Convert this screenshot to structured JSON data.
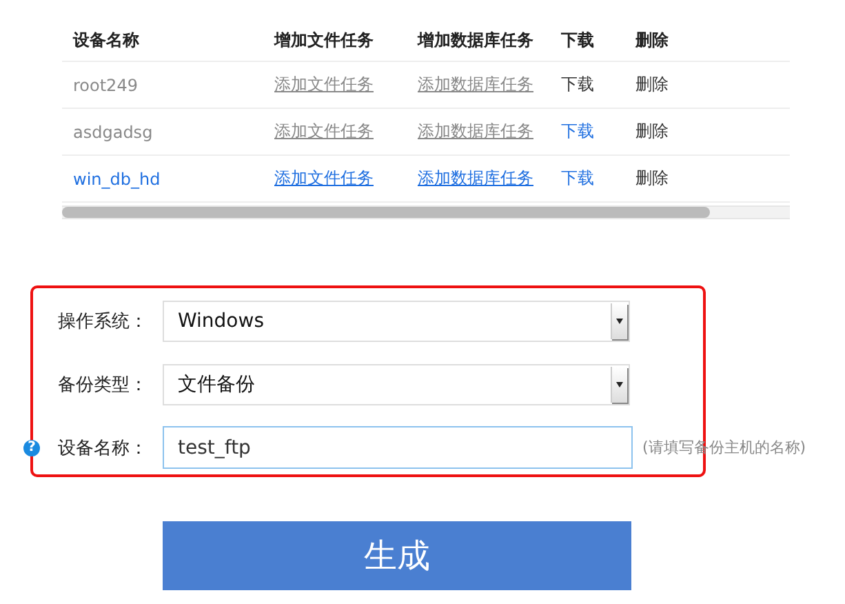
{
  "table": {
    "columns": [
      "设备名称",
      "增加文件任务",
      "增加数据库任务",
      "下载",
      "删除"
    ],
    "rows": [
      {
        "name": "root249",
        "add_file_task": "添加文件任务",
        "add_db_task": "添加数据库任务",
        "download": "下载",
        "download_active": false,
        "delete": "删除",
        "selected": false
      },
      {
        "name": "asdgadsg",
        "add_file_task": "添加文件任务",
        "add_db_task": "添加数据库任务",
        "download": "下载",
        "download_active": true,
        "delete": "删除",
        "selected": false
      },
      {
        "name": "win_db_hd",
        "add_file_task": "添加文件任务",
        "add_db_task": "添加数据库任务",
        "download": "下载",
        "download_active": true,
        "delete": "删除",
        "selected": true
      }
    ]
  },
  "form": {
    "highlighted": true,
    "fields": [
      {
        "kind": "select",
        "label": "操作系统：",
        "value": "Windows"
      },
      {
        "kind": "select",
        "label": "备份类型：",
        "value": "文件备份"
      },
      {
        "kind": "input",
        "label": "设备名称：",
        "value": "test_ftp",
        "help": "?",
        "hint": "(请填写备份主机的名称)"
      }
    ]
  },
  "submit": "生成"
}
